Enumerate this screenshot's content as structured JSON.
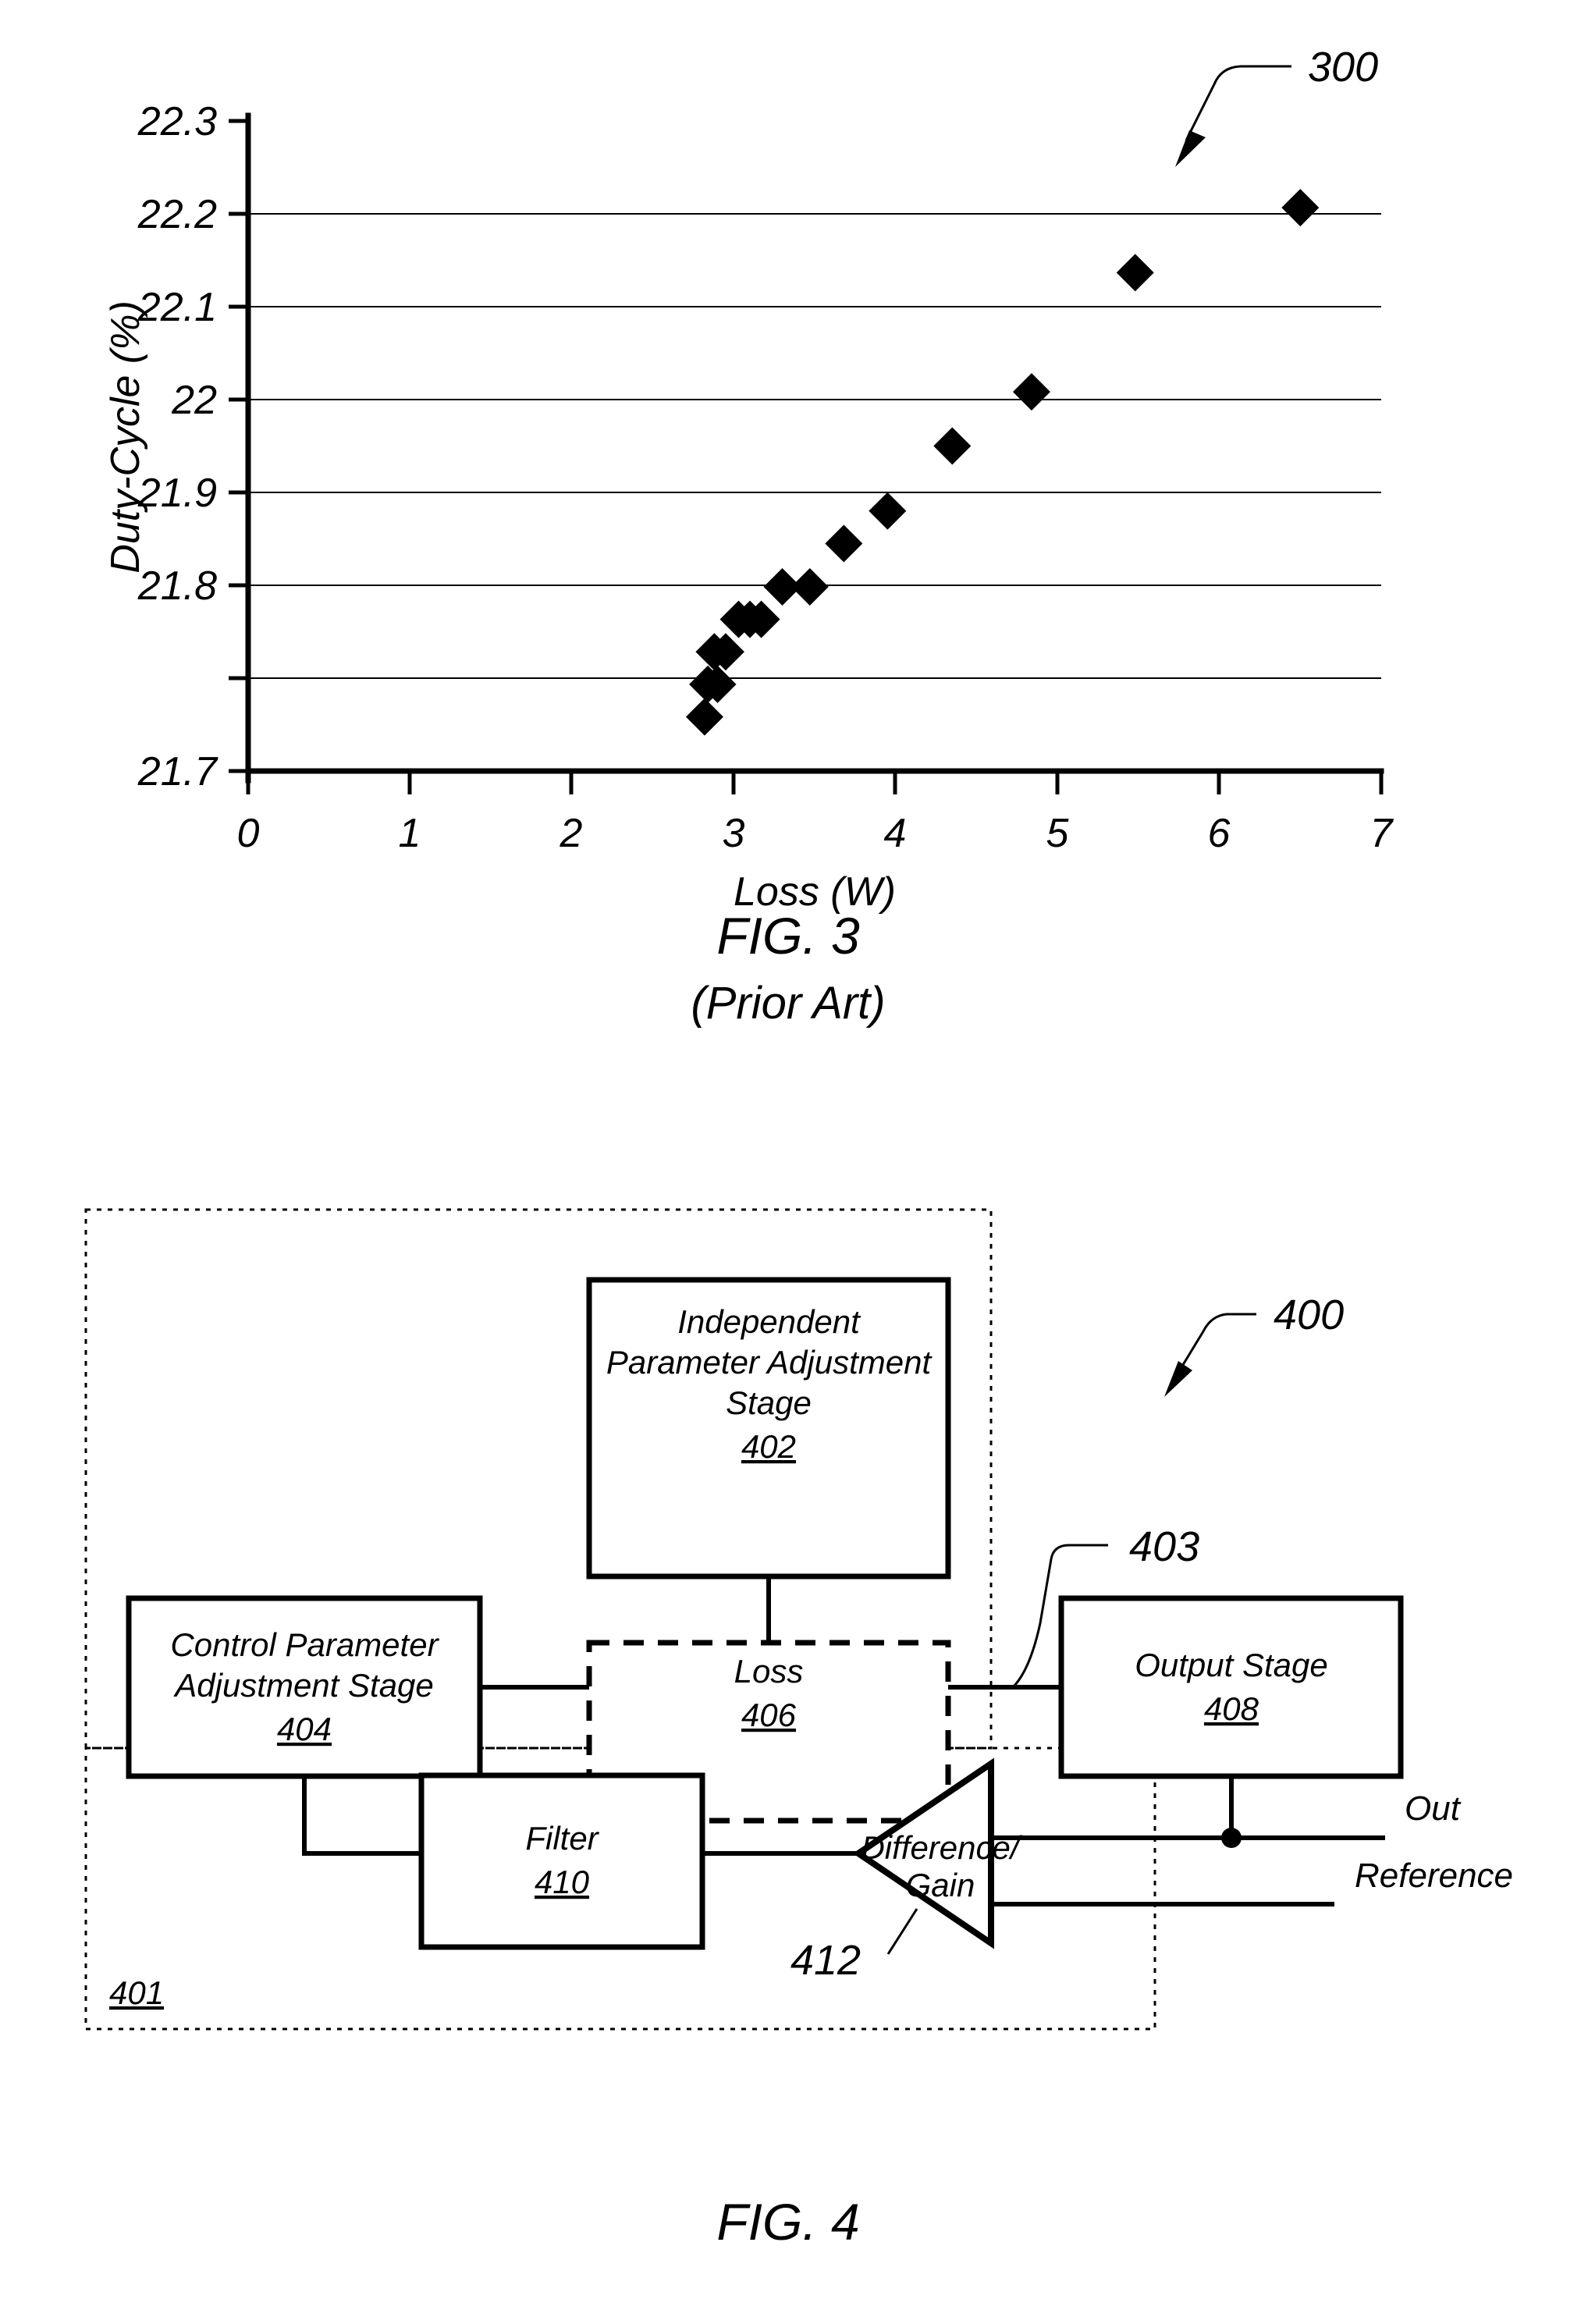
{
  "figures": {
    "fig3": {
      "caption": "FIG. 3",
      "subcaption": "(Prior Art)",
      "callout": "300"
    },
    "fig4": {
      "caption": "FIG. 4",
      "callout": "400",
      "node_callout": "403",
      "container_ref": "401",
      "amp_callout": "412"
    }
  },
  "chart_data": {
    "type": "scatter",
    "title": "",
    "xlabel": "Loss (W)",
    "ylabel": "Duty-Cycle (%)",
    "xlim": [
      0,
      7
    ],
    "ylim": [
      21.7,
      22.3
    ],
    "xticks": [
      "0",
      "1",
      "2",
      "3",
      "4",
      "5",
      "6",
      "7"
    ],
    "xtick_values": [
      0,
      1,
      2,
      3,
      4,
      5,
      6,
      7
    ],
    "yticks": [
      "21.7",
      "21.8",
      "21.9",
      "22",
      "22.1",
      "22.2",
      "22.3"
    ],
    "ytick_values": [
      21.7,
      21.8,
      21.9,
      22.0,
      22.1,
      22.2,
      22.3
    ],
    "grid": true,
    "grid_axis": "y",
    "legend": false,
    "marker": "diamond",
    "marker_color": "#000000",
    "points": [
      {
        "x": 2.82,
        "y": 21.75
      },
      {
        "x": 2.84,
        "y": 21.78
      },
      {
        "x": 2.9,
        "y": 21.78
      },
      {
        "x": 2.88,
        "y": 21.81
      },
      {
        "x": 2.95,
        "y": 21.81
      },
      {
        "x": 3.03,
        "y": 21.84
      },
      {
        "x": 3.1,
        "y": 21.84
      },
      {
        "x": 3.17,
        "y": 21.84
      },
      {
        "x": 3.3,
        "y": 21.87
      },
      {
        "x": 3.47,
        "y": 21.87
      },
      {
        "x": 3.68,
        "y": 21.91
      },
      {
        "x": 3.95,
        "y": 21.94
      },
      {
        "x": 4.35,
        "y": 22.0
      },
      {
        "x": 4.84,
        "y": 22.05
      },
      {
        "x": 5.48,
        "y": 22.16
      },
      {
        "x": 6.5,
        "y": 22.22
      }
    ]
  },
  "diagram": {
    "blocks": [
      {
        "id": "independent-parameter-adjustment-stage",
        "lines": [
          "Independent",
          "Parameter Adjustment",
          "Stage"
        ],
        "ref": "402",
        "style": "solid"
      },
      {
        "id": "control-parameter-adjustment-stage",
        "lines": [
          "Control Parameter",
          "Adjustment Stage"
        ],
        "ref": "404",
        "style": "solid"
      },
      {
        "id": "loss",
        "lines": [
          "Loss"
        ],
        "ref": "406",
        "style": "dashed"
      },
      {
        "id": "output-stage",
        "lines": [
          "Output Stage"
        ],
        "ref": "408",
        "style": "solid"
      },
      {
        "id": "filter",
        "lines": [
          "Filter"
        ],
        "ref": "410",
        "style": "solid"
      },
      {
        "id": "difference-gain",
        "lines": [
          "Difference/",
          "Gain"
        ],
        "ref": "412",
        "style": "triangle"
      }
    ],
    "io": {
      "out": "Out",
      "reference": "Reference"
    }
  }
}
